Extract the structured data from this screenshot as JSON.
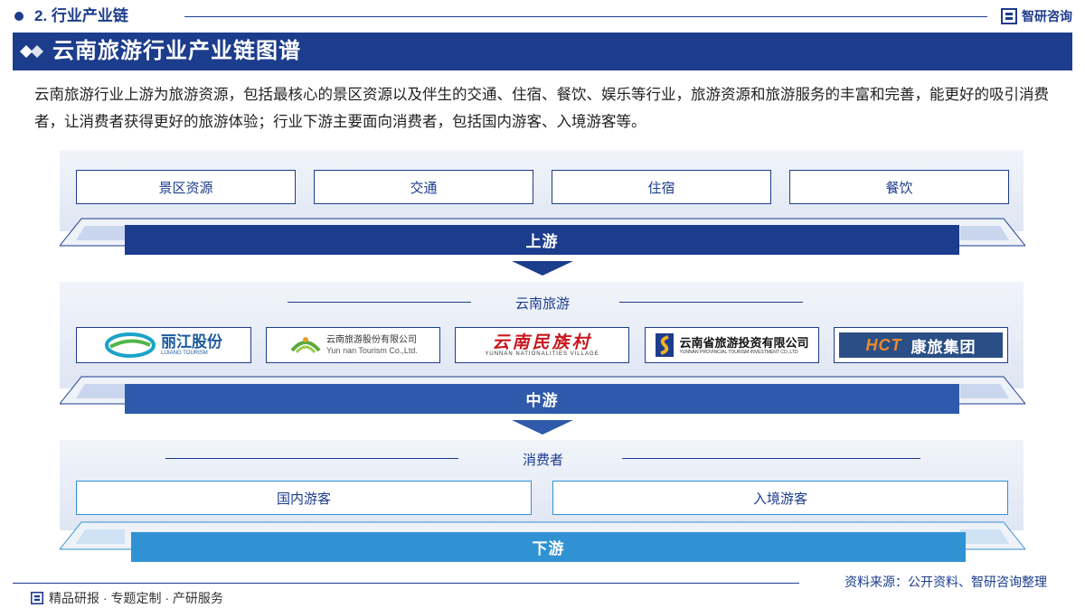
{
  "header": {
    "section": "2. 行业产业链",
    "brand": "智研咨询"
  },
  "title": "云南旅游行业产业链图谱",
  "intro": "云南旅游行业上游为旅游资源，包括最核心的景区资源以及伴生的交通、住宿、餐饮、娱乐等行业，旅游资源和旅游服务的丰富和完善，能更好的吸引消费者，让消费者获得更好的旅游体验；行业下游主要面向消费者，包括国内游客、入境游客等。",
  "upstream": {
    "items": [
      "景区资源",
      "交通",
      "住宿",
      "餐饮"
    ],
    "label": "上游"
  },
  "midstream": {
    "title": "云南旅游",
    "logos": {
      "lijiang": {
        "cn": "丽江股份",
        "en": "LIJIANG TOURISM"
      },
      "yntour": {
        "cn": "云南旅游股份有限公司",
        "en": "Yun nan Tourism Co.,Ltd."
      },
      "village": {
        "cn": "云南民族村",
        "en": "YUNNAN NATIONALITIES VILLAGE"
      },
      "ytig": {
        "cn": "云南省旅游投资有限公司",
        "en": "YUNNAN PROVINCIAL TOURISM INVESTMENT CO.,LTD"
      },
      "hct": {
        "mark": "HCT",
        "cn": "康旅集团"
      }
    },
    "label": "中游"
  },
  "downstream": {
    "title": "消费者",
    "items": [
      "国内游客",
      "入境游客"
    ],
    "label": "下游"
  },
  "footer": {
    "source": "资料来源：公开资料、智研咨询整理",
    "tagline": "精品研报 · 专题定制 · 产研服务"
  },
  "colors": {
    "primary": "#1c3c8c",
    "mid": "#2f5aab",
    "down": "#3192d3",
    "panel": "#e4eaf5"
  }
}
